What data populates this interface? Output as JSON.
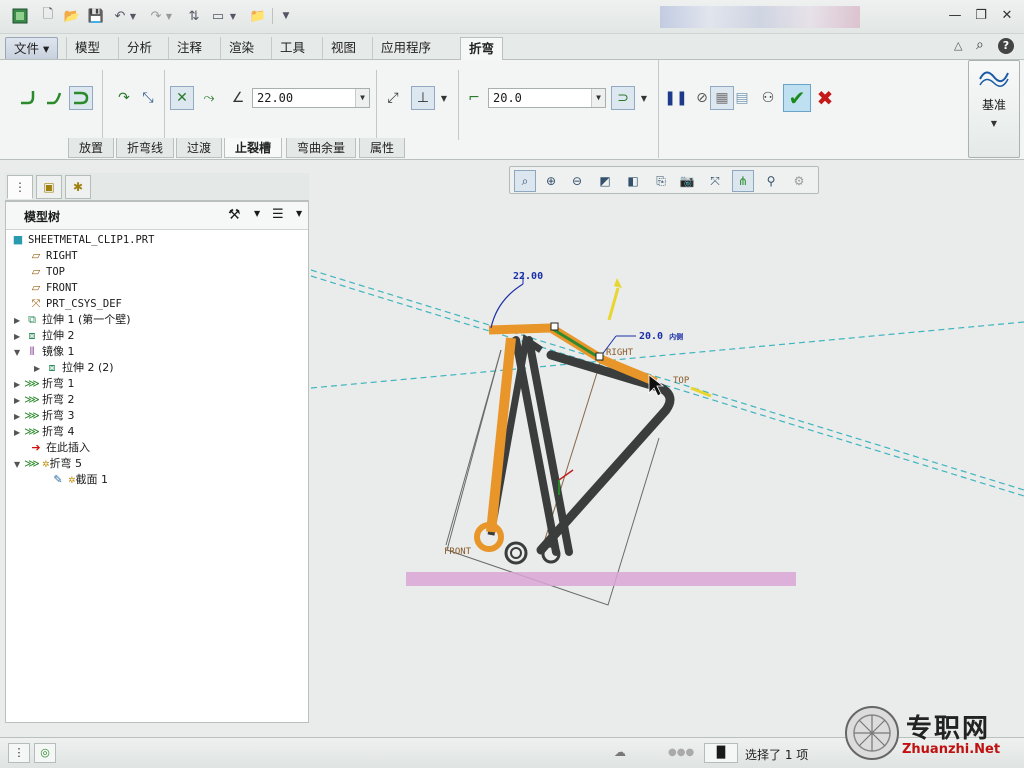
{
  "tabs": {
    "file": "文件",
    "items": [
      "模型",
      "分析",
      "注释",
      "渲染",
      "工具",
      "视图",
      "应用程序"
    ],
    "active": "折弯"
  },
  "ribbon": {
    "angle_value": "22.00",
    "radius_value": "20.0",
    "subtabs": [
      "放置",
      "折弯线",
      "过渡",
      "止裂槽",
      "弯曲余量",
      "属性"
    ],
    "active_subtab": "止裂槽",
    "datum_label": "基准"
  },
  "tree": {
    "title": "模型树",
    "rows": [
      {
        "label": "SHEETMETAL_CLIP1.PRT",
        "icon": "part-icon",
        "mono": true
      },
      {
        "label": "RIGHT",
        "icon": "datum-plane-icon",
        "mono": true
      },
      {
        "label": "TOP",
        "icon": "datum-plane-icon",
        "mono": true
      },
      {
        "label": "FRONT",
        "icon": "datum-plane-icon",
        "mono": true
      },
      {
        "label": "PRT_CSYS_DEF",
        "icon": "csys-icon",
        "mono": true
      },
      {
        "label": "拉伸 1 (第一个壁)",
        "icon": "extrude-wall-icon"
      },
      {
        "label": "拉伸 2",
        "icon": "extrude-icon"
      },
      {
        "label": "镜像 1",
        "icon": "mirror-icon"
      },
      {
        "label": "拉伸 2 (2)",
        "icon": "extrude-icon"
      },
      {
        "label": "折弯 1",
        "icon": "bend-icon"
      },
      {
        "label": "折弯 2",
        "icon": "bend-icon"
      },
      {
        "label": "折弯 3",
        "icon": "bend-icon"
      },
      {
        "label": "折弯 4",
        "icon": "bend-icon"
      },
      {
        "label": "在此插入",
        "icon": "insert-here-icon"
      },
      {
        "label": "折弯 5",
        "icon": "bend-icon"
      },
      {
        "label": "截面 1",
        "icon": "sketch-icon"
      }
    ]
  },
  "viewport": {
    "dim_angle": "22.00",
    "dim_radius": "20.0",
    "dim_radius_suffix": "内侧",
    "label_right": "RIGHT",
    "label_top": "TOP",
    "label_front": "FRONT"
  },
  "status": {
    "selection": "选择了 1 项"
  },
  "watermark": {
    "cn": "专职网",
    "url": "Zhuanzhi.Net"
  },
  "colors": {
    "accent_orange": "#e8962a",
    "part_dark": "#3a3d3c",
    "datum_cyan": "#3fb5c0",
    "dimension_blue": "#1c2fa8"
  }
}
